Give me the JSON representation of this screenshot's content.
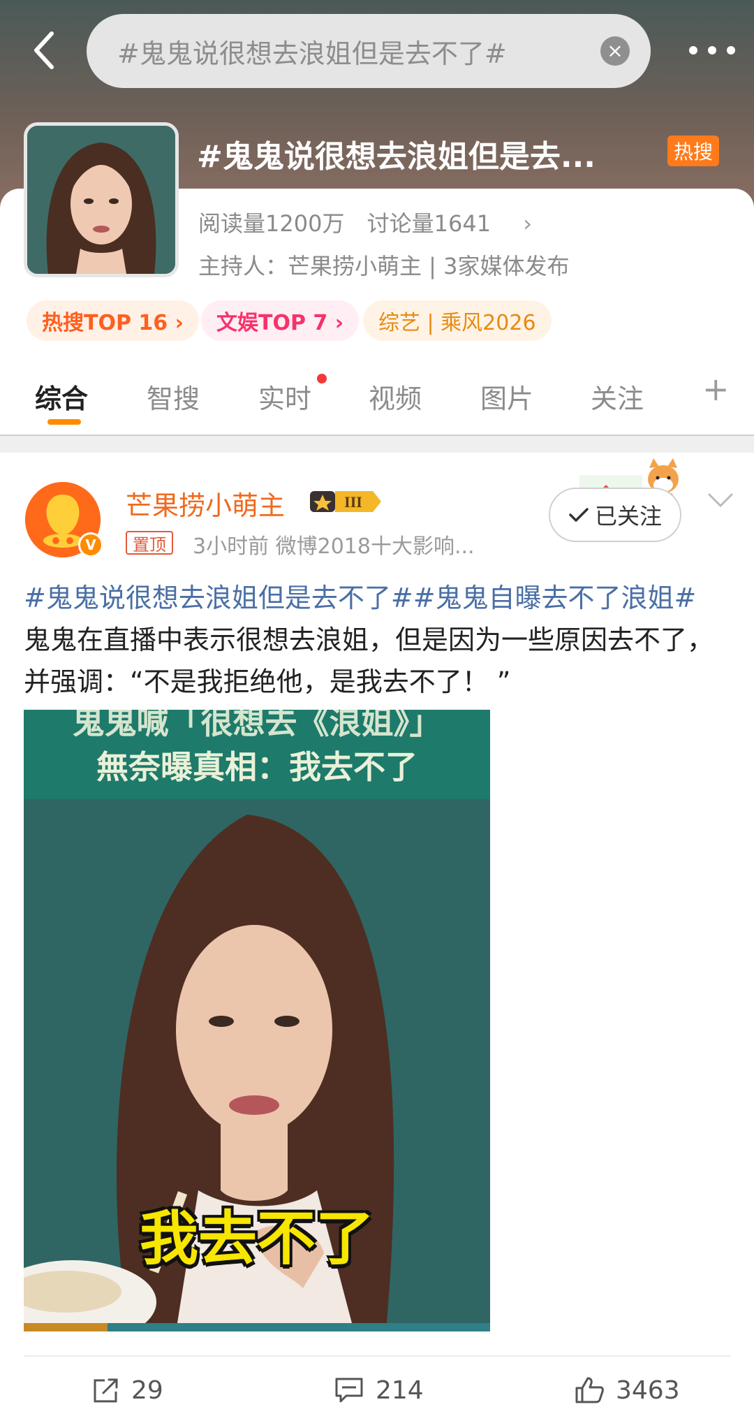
{
  "search": {
    "query": "#鬼鬼说很想去浪姐但是去不了#"
  },
  "topic": {
    "title": "#鬼鬼说很想去浪姐但是去...",
    "hot_badge": "热搜",
    "reads": "阅读量1200万",
    "discussions": "讨论量1641",
    "host": "主持人：芒果捞小萌主 | 3家媒体发布",
    "pills": [
      "热搜TOP 16 ›",
      "文娱TOP 7 ›",
      "综艺 | 乘风2026"
    ]
  },
  "tabs": [
    {
      "label": "综合",
      "active": true
    },
    {
      "label": "智搜"
    },
    {
      "label": "实时",
      "has_dot": true
    },
    {
      "label": "视频"
    },
    {
      "label": "图片"
    },
    {
      "label": "关注"
    }
  ],
  "post": {
    "author": "芒果捞小萌主",
    "pinned_label": "置顶",
    "meta": "3小时前   微博2018十大影响...",
    "follow_label": "已关注",
    "tag1": "#鬼鬼说很想去浪姐但是去不了#",
    "tag2": "#鬼鬼自曝去不了浪姐#",
    "body": " 鬼鬼在直播中表示很想去浪姐，但是因为一些原因去不了，并强调：“不是我拒绝他，是我去不了！ ”",
    "image": {
      "line1": "鬼鬼喊「很想去《浪姐》」",
      "line2": "無奈曝真相：我去不了",
      "caption": "我去不了",
      "progress": 0.18
    },
    "reposts": "29",
    "comments": "214",
    "likes": "3463"
  },
  "colors": {
    "accent": "#ff8c00",
    "link": "#4a6fa5",
    "author": "#ef6a1e"
  }
}
